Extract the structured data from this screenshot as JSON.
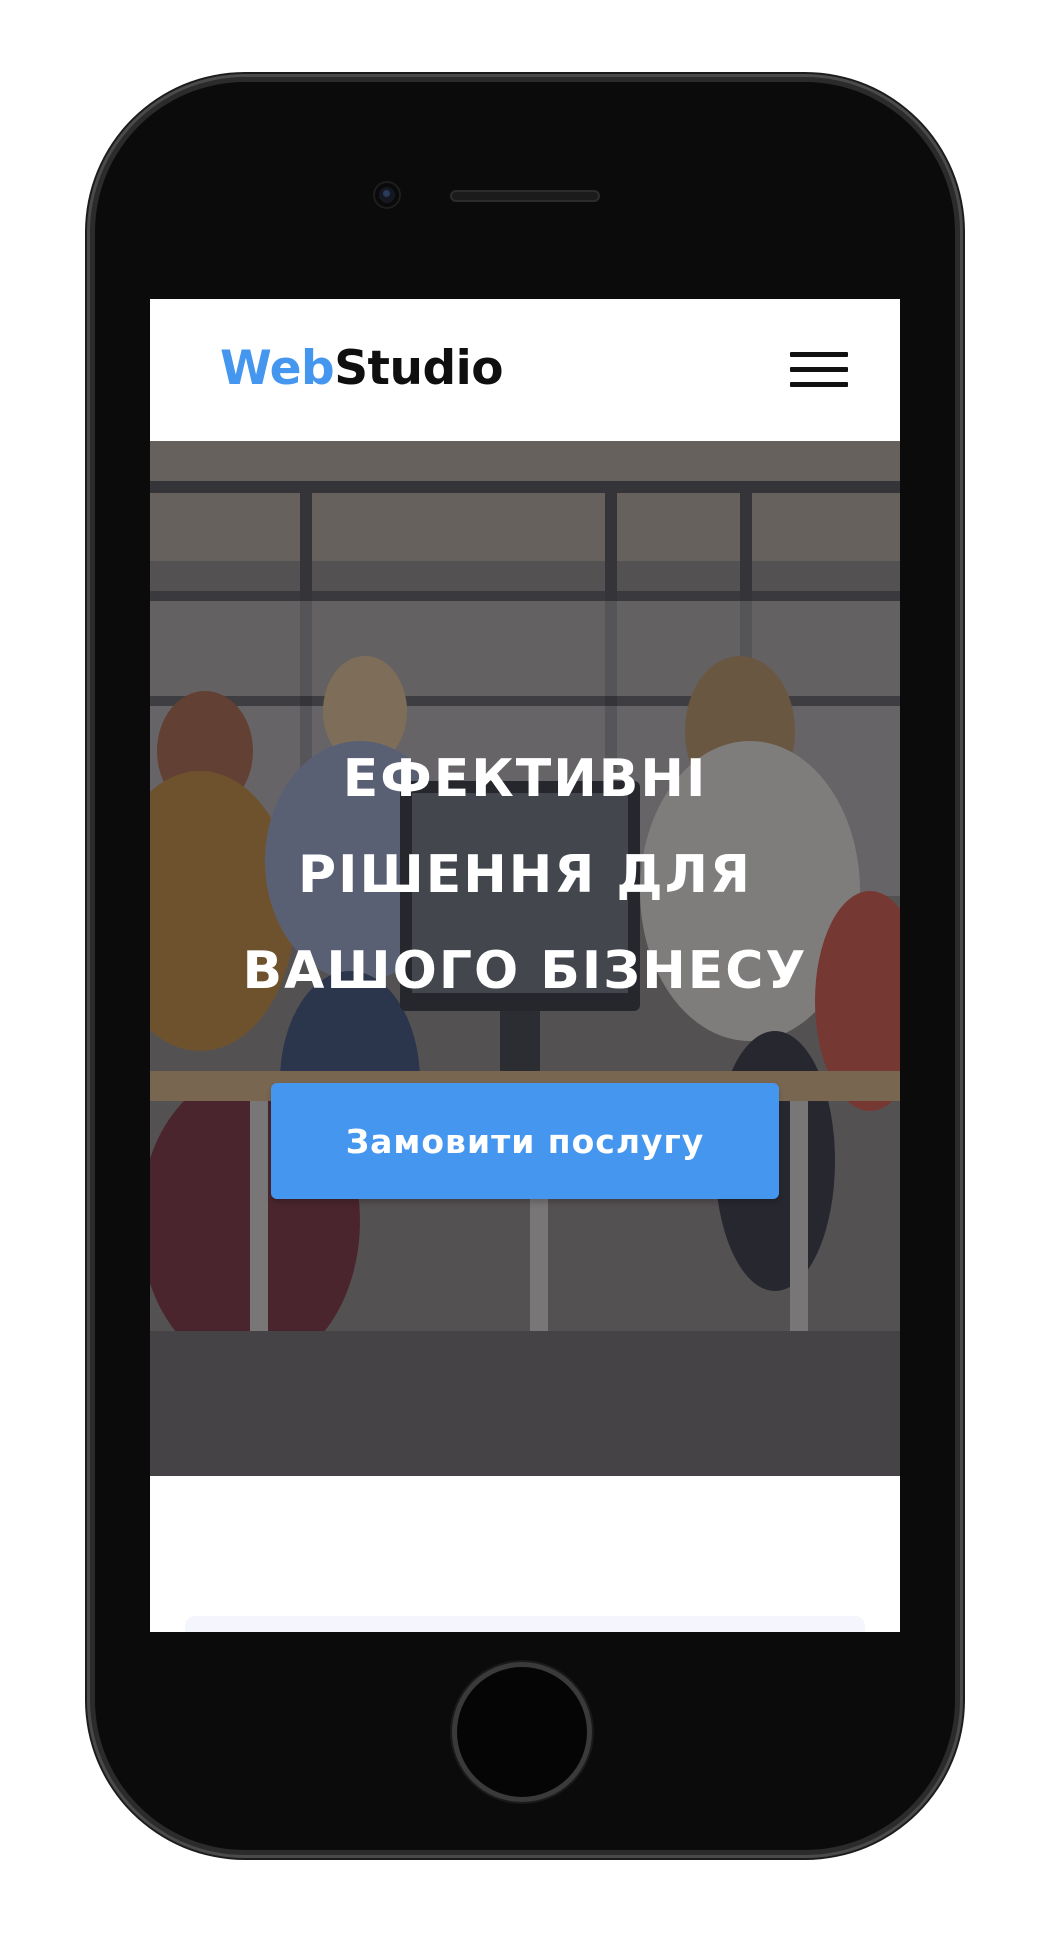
{
  "header": {
    "logo_accent": "Web",
    "logo_rest": "Studio",
    "menu_icon": "hamburger-menu-icon"
  },
  "hero": {
    "title": "Ефективні рішення для вашого бізнесу",
    "cta_label": "Замовити послугу"
  },
  "colors": {
    "accent": "#4596ee",
    "text_dark": "#0f0f0f",
    "overlay": "rgba(33,32,40,0.52)"
  }
}
